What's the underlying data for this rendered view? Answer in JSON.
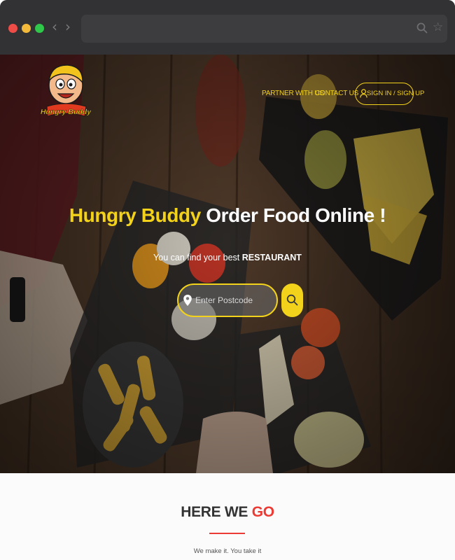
{
  "colors": {
    "brand_yellow": "#f2d21a",
    "accent_red": "#ec3b34",
    "chrome_dark": "#323234"
  },
  "browser": {
    "back_icon": "chevron-left-icon",
    "forward_icon": "chevron-right-icon",
    "search_icon": "search-icon",
    "bookmark_icon": "star-icon"
  },
  "logo": {
    "text": "Hungry Buddy"
  },
  "nav": {
    "partner": "PARTNER WITH US",
    "contact": "CONTACT US",
    "sign_in": "SIGN IN / SIGN UP",
    "sign_icon": "user-icon"
  },
  "hero": {
    "headline_brand": "Hungry Buddy",
    "headline_rest": " Order Food Online !",
    "sub_prefix": "You can find your best ",
    "sub_strong": "RESTAURANT"
  },
  "search": {
    "placeholder": "Enter Postcode",
    "value": "",
    "pin_icon": "map-pin-icon",
    "button_icon": "search-icon"
  },
  "section": {
    "title_main": "HERE WE ",
    "title_accent": "GO",
    "tagline": "We make it. You take it"
  }
}
